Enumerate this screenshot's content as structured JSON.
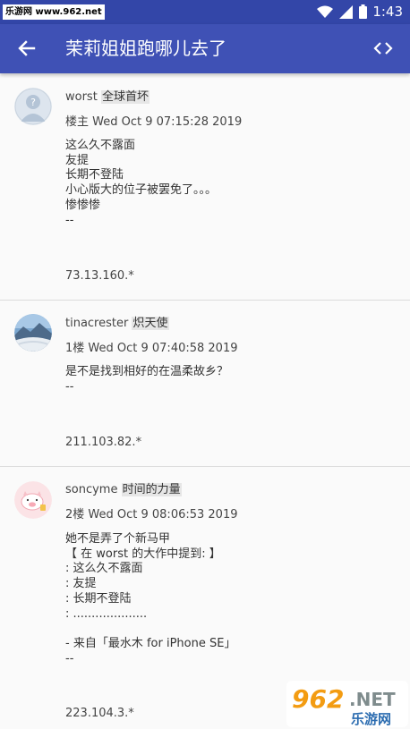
{
  "status_bar": {
    "watermark": "乐游网 www.962.net",
    "time": "1:43"
  },
  "app_bar": {
    "title": "茉莉姐姐跑哪儿去了"
  },
  "posts": [
    {
      "author": "worst",
      "title_tag": "全球首坏",
      "floor_time": "楼主 Wed Oct 9 07:15:28 2019",
      "content": "这么久不露面\n友提\n长期不登陆\n小心版大的位子被罢免了。。。\n惨惨惨\n--",
      "ip": "73.13.160.*"
    },
    {
      "author": "tinacrester",
      "title_tag": "炽天使",
      "floor_time": "1楼 Wed Oct 9 07:40:58 2019",
      "content": "是不是找到相好的在温柔故乡？\n--",
      "ip": "211.103.82.*"
    },
    {
      "author": "soncyme",
      "title_tag": "时间的力量",
      "floor_time": "2楼 Wed Oct 9 08:06:53 2019",
      "content": "她不是弄了个新马甲\n【 在 worst 的大作中提到: 】\n: 这么久不露面\n: 友提\n: 长期不登陆\n: ....................\n\n- 来自「最水木 for iPhone SE」\n--",
      "ip": "223.104.3.*"
    }
  ],
  "footer_logo": {
    "text_top": "962",
    "text_dot_net": ".NET",
    "text_bottom": "乐游网"
  }
}
